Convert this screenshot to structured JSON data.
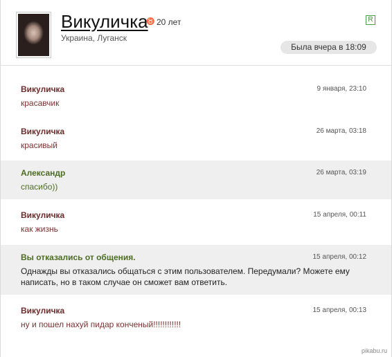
{
  "profile": {
    "name": "Викуличка",
    "age": "20 лет",
    "location": "Украина, Луганск",
    "badge": "R",
    "last_seen": "Была вчера в 18:09",
    "age_icon": "zodiac-icon"
  },
  "messages": [
    {
      "author": "Викуличка",
      "time": "9 января, 23:10",
      "text": "красавчик"
    },
    {
      "author": "Викуличка",
      "time": "26 марта, 03:18",
      "text": "красивый"
    },
    {
      "author": "Александр",
      "time": "26 марта, 03:19",
      "text": "спасибо))"
    },
    {
      "author": "Викуличка",
      "time": "15 апреля, 00:11",
      "text": "как жизнь"
    },
    {
      "author": "Вы отказались от общения.",
      "time": "15 апреля, 00:12",
      "text": "Однажды вы отказались общаться с этим пользователем. Передумали? Можете ему написать, но в таком случае он сможет вам ответить."
    },
    {
      "author": "Викуличка",
      "time": "15 апреля, 00:13",
      "text": "ну и пошел нахуй пидар конченый!!!!!!!!!!!!"
    }
  ],
  "watermark": "pikabu.ru",
  "colors": {
    "female_name": "#6b2c2c",
    "male_name": "#4c6c22",
    "alt_row_bg": "#efefef"
  }
}
